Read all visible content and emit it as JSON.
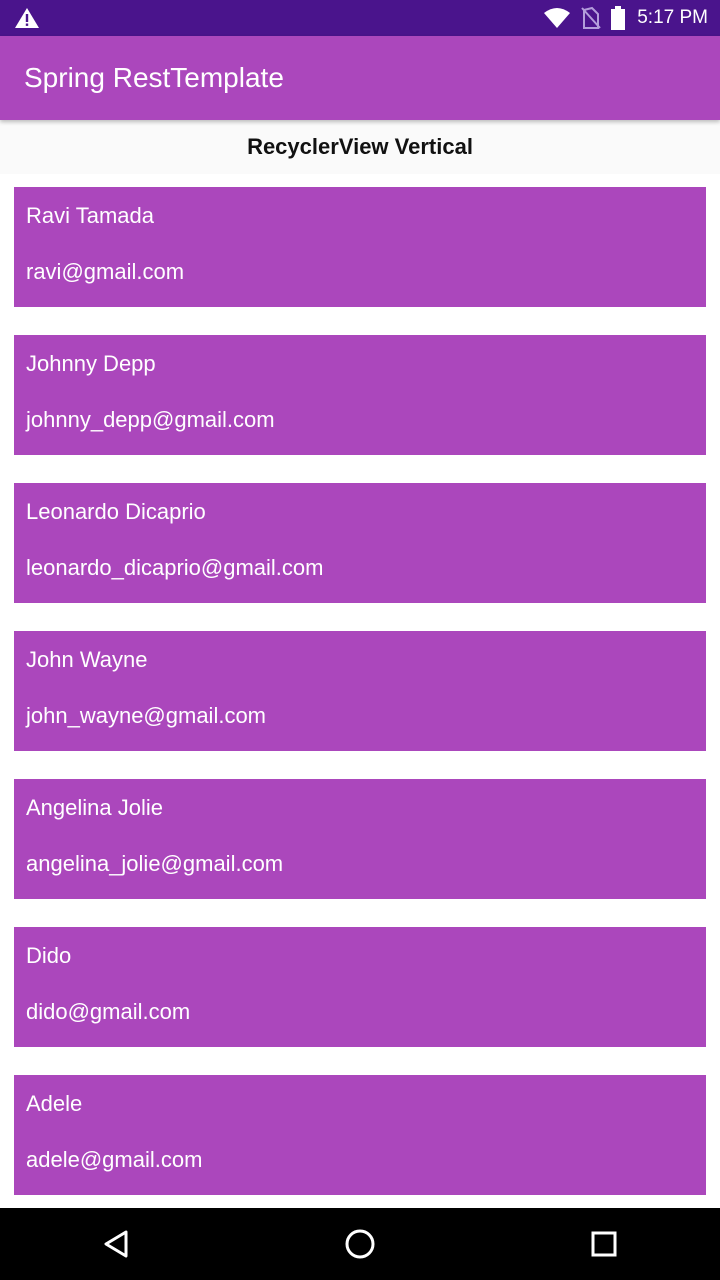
{
  "status_bar": {
    "time": "5:17 PM",
    "icons": [
      "warning-icon",
      "wifi-icon",
      "no-sim-icon",
      "battery-icon"
    ]
  },
  "app_bar": {
    "title": "Spring RestTemplate"
  },
  "subheader": {
    "title": "RecyclerView Vertical"
  },
  "users": [
    {
      "name": "Ravi Tamada",
      "email": "ravi@gmail.com"
    },
    {
      "name": "Johnny Depp",
      "email": "johnny_depp@gmail.com"
    },
    {
      "name": "Leonardo Dicaprio",
      "email": "leonardo_dicaprio@gmail.com"
    },
    {
      "name": "John Wayne",
      "email": "john_wayne@gmail.com"
    },
    {
      "name": "Angelina Jolie",
      "email": "angelina_jolie@gmail.com"
    },
    {
      "name": "Dido",
      "email": "dido@gmail.com"
    },
    {
      "name": "Adele",
      "email": "adele@gmail.com"
    }
  ],
  "nav_bar": {
    "buttons": [
      "back-icon",
      "home-icon",
      "recents-icon"
    ]
  },
  "colors": {
    "status_bar": "#4a148c",
    "primary": "#ab47bc",
    "card": "#ab47bc"
  }
}
